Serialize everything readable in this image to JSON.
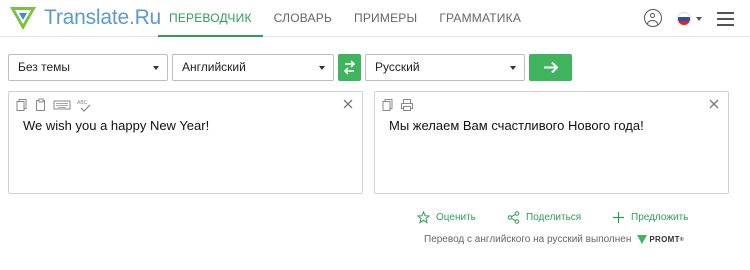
{
  "header": {
    "logo_text": "Translate.Ru",
    "nav": [
      {
        "label": "ПЕРЕВОДЧИК",
        "active": true
      },
      {
        "label": "СЛОВАРЬ",
        "active": false
      },
      {
        "label": "ПРИМЕРЫ",
        "active": false
      },
      {
        "label": "ГРАММАТИКА",
        "active": false
      }
    ]
  },
  "toolbar": {
    "topic_select": "Без темы",
    "source_lang": "Английский",
    "target_lang": "Русский"
  },
  "source": {
    "text": "We wish you a happy New Year!"
  },
  "target": {
    "text": "Мы желаем Вам счастливого Нового года!"
  },
  "actions": {
    "rate": "Оценить",
    "share": "Поделиться",
    "suggest": "Предложить"
  },
  "credit": {
    "text": "Перевод с английского на русский выполнен",
    "brand": "PROMT"
  },
  "colors": {
    "accent": "#3fb35e",
    "logo": "#5a9bd0"
  }
}
